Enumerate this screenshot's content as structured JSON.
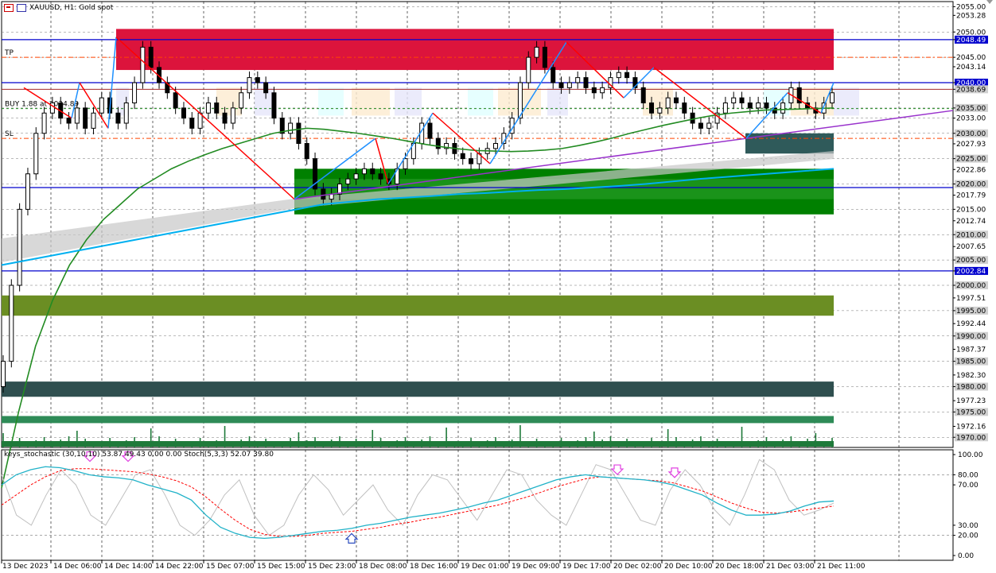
{
  "header": {
    "symbol_label": "XAUUSD, H1:  Gold spot"
  },
  "objects": {
    "tp_label": "TP",
    "sl_label": "SL",
    "buy_label": "BUY 1.88 at 2034.89"
  },
  "indicator": {
    "label": "keys_stochastic (30,10,10) 53.87 49.43 0.00 0.00 Stoch(5,3,3) 52.07 39.80"
  },
  "price_axis": {
    "ticks": [
      "2055.00",
      "2053.28",
      "2050.00",
      "2048.49",
      "2045.00",
      "2043.14",
      "2040.00",
      "2038.69",
      "2035.00",
      "2033.00",
      "2030.00",
      "2027.93",
      "2025.00",
      "2022.86",
      "2020.00",
      "2017.79",
      "2015.00",
      "2012.74",
      "2010.00",
      "2007.65",
      "2005.00",
      "2002.84",
      "2000.00",
      "1997.51",
      "1995.00",
      "1992.44",
      "1990.00",
      "1987.37",
      "1985.00",
      "1982.30",
      "1980.00",
      "1977.23",
      "1975.00",
      "1972.16",
      "1970.00"
    ],
    "highlighted": [
      "2048.49",
      "2040.00",
      "2038.69",
      "2035.00",
      "2030.00",
      "2025.00",
      "2020.00",
      "2010.00",
      "2005.00",
      "2002.84",
      "2000.00",
      "1995.00",
      "1990.00",
      "1985.00",
      "1980.00",
      "1975.00",
      "1970.00"
    ]
  },
  "stoch_axis": {
    "ticks": [
      "100.00",
      "80.00",
      "70.00",
      "30.00",
      "20.00",
      "0.00"
    ]
  },
  "time_axis": {
    "ticks": [
      "13 Dec 2023",
      "14 Dec 06:00",
      "14 Dec 14:00",
      "14 Dec 22:00",
      "15 Dec 07:00",
      "15 Dec 15:00",
      "15 Dec 23:00",
      "18 Dec 08:00",
      "18 Dec 16:00",
      "19 Dec 01:00",
      "19 Dec 09:00",
      "19 Dec 17:00",
      "20 Dec 02:00",
      "20 Dec 10:00",
      "20 Dec 18:00",
      "21 Dec 03:00",
      "21 Dec 11:00"
    ]
  },
  "colors": {
    "resistance_zone": "#dc143c",
    "support_zone": "#008000",
    "olive_zone": "#6b8e23",
    "slate_zone": "#2f4f4f",
    "seagreen_zone": "#2e8b57",
    "hline": "#0000cd",
    "ma_green": "#228b22",
    "ma_cyan": "#00b0f0",
    "trend_purple": "#9932cc",
    "zigzag_red": "#ff0000",
    "zigzag_blue": "#1e90ff"
  },
  "chart_data": {
    "type": "candlestick",
    "symbol": "XAUUSD",
    "timeframe": "H1",
    "price_range": [
      1968,
      2056
    ],
    "levels": {
      "tp": 2045.0,
      "buy": 2034.89,
      "sl": 2029.0,
      "blue_lines": [
        2048.49,
        2040.0,
        2019.3,
        2002.84
      ]
    },
    "zones": [
      {
        "name": "resistance",
        "top": 2050.6,
        "bottom": 2042.5
      },
      {
        "name": "support",
        "top": 2023.0,
        "bottom": 2014.0
      },
      {
        "name": "olive",
        "top": 1998.0,
        "bottom": 1994.0
      },
      {
        "name": "slate",
        "top": 1981.0,
        "bottom": 1978.0
      },
      {
        "name": "seagreen",
        "top": 1974.2,
        "bottom": 1972.8
      }
    ],
    "candles_close": [
      1985,
      2000,
      2015,
      2022,
      2030,
      2034,
      2036,
      2033,
      2032,
      2035,
      2031,
      2034,
      2037,
      2034,
      2032,
      2036,
      2040,
      2047,
      2043,
      2040,
      2038,
      2035,
      2033,
      2031,
      2034,
      2036,
      2034,
      2032,
      2035,
      2038,
      2041,
      2040,
      2038,
      2033,
      2030,
      2032,
      2028,
      2025,
      2019,
      2017,
      2018,
      2020,
      2021,
      2022,
      2023,
      2022,
      2021,
      2020,
      2023,
      2025,
      2028,
      2032,
      2029,
      2027,
      2028,
      2026,
      2025,
      2024,
      2026,
      2027,
      2028,
      2030,
      2033,
      2040,
      2045,
      2047,
      2043,
      2040,
      2039,
      2040,
      2041,
      2039,
      2038,
      2039,
      2041,
      2042,
      2041,
      2039,
      2036,
      2034,
      2035,
      2037,
      2036,
      2034,
      2032,
      2031,
      2032,
      2034,
      2036,
      2037,
      2036,
      2035,
      2036,
      2035,
      2034,
      2036,
      2039,
      2036,
      2035,
      2034,
      2036,
      2038
    ],
    "ma_green": [
      1960,
      1975,
      1988,
      1997,
      2004,
      2009,
      2013,
      2016,
      2019,
      2021,
      2023,
      2024.5,
      2025.8,
      2027,
      2028,
      2029,
      2030,
      2030.6,
      2031,
      2030.8,
      2030.4,
      2030,
      2029.5,
      2029,
      2028.4,
      2027.8,
      2027.3,
      2026.9,
      2026.6,
      2026.5,
      2026.4,
      2026.5,
      2026.7,
      2027,
      2027.6,
      2028.3,
      2029.1,
      2030,
      2030.8,
      2031.6,
      2032.3,
      2033,
      2033.6,
      2034,
      2034.3,
      2034.6,
      2034.7,
      2034.8,
      2034.9,
      2035
    ],
    "ma_cyan": [
      2004,
      2005,
      2006,
      2007,
      2008,
      2009,
      2010,
      2011,
      2012,
      2013,
      2014,
      2015,
      2016,
      2016.5,
      2017,
      2017.3,
      2017.6,
      2018,
      2018.2,
      2018.5,
      2018.8,
      2019,
      2019.3,
      2019.6,
      2020,
      2020.5,
      2021,
      2021.4,
      2021.8,
      2022.2,
      2022.6,
      2023
    ],
    "stoch_main": [
      70,
      80,
      85,
      88,
      87,
      84,
      80,
      78,
      77,
      75,
      70,
      66,
      62,
      55,
      40,
      28,
      22,
      18,
      17,
      18,
      20,
      22,
      24,
      25,
      27,
      30,
      32,
      35,
      38,
      40,
      42,
      45,
      48,
      52,
      55,
      60,
      65,
      70,
      75,
      78,
      80,
      78,
      77,
      76,
      75,
      73,
      70,
      65,
      60,
      52,
      45,
      40,
      40,
      41,
      44,
      49,
      53,
      54
    ],
    "stoch_signal": [
      50,
      60,
      70,
      78,
      84,
      86,
      86,
      85,
      84,
      83,
      81,
      78,
      74,
      68,
      58,
      46,
      35,
      26,
      21,
      19,
      19,
      20,
      22,
      23,
      24,
      26,
      28,
      31,
      33,
      36,
      38,
      41,
      44,
      47,
      50,
      54,
      58,
      63,
      68,
      72,
      76,
      78,
      77,
      76,
      75,
      74,
      72,
      68,
      64,
      58,
      52,
      47,
      43,
      42,
      43,
      45,
      47,
      49
    ],
    "stoch_fast": [
      80,
      40,
      30,
      60,
      85,
      70,
      40,
      30,
      55,
      80,
      85,
      60,
      30,
      20,
      35,
      60,
      75,
      40,
      20,
      30,
      60,
      80,
      65,
      40,
      55,
      70,
      45,
      30,
      60,
      80,
      75,
      55,
      35,
      60,
      85,
      80,
      55,
      40,
      30,
      60,
      90,
      85,
      60,
      35,
      30,
      65,
      85,
      70,
      45,
      30,
      60,
      95,
      85,
      55,
      40,
      45,
      52
    ]
  }
}
